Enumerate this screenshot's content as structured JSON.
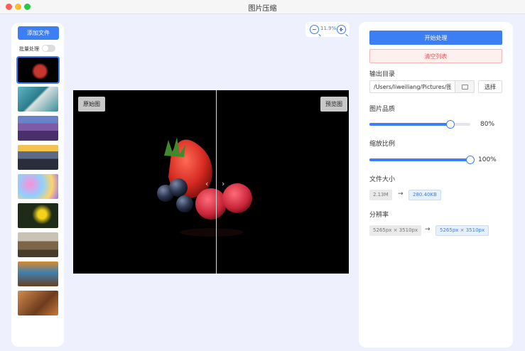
{
  "window": {
    "title": "图片压缩"
  },
  "sidebar": {
    "add_files_label": "添加文件",
    "batch_label": "批量处理",
    "batch_enabled": false,
    "thumbnails": [
      {
        "name": "strawberries",
        "active": true
      },
      {
        "name": "coast"
      },
      {
        "name": "lavender-field"
      },
      {
        "name": "mountain-sunset"
      },
      {
        "name": "bokeh"
      },
      {
        "name": "yellow-flowers"
      },
      {
        "name": "boardwalk"
      },
      {
        "name": "waterfall"
      },
      {
        "name": "autumn-deer"
      }
    ]
  },
  "preview": {
    "zoom_level": "11.9%",
    "original_tag": "原始图",
    "preview_tag": "预览图",
    "left_arrow": "‹",
    "right_arrow": "›"
  },
  "panel": {
    "start_label": "开始处理",
    "clear_label": "清空列表",
    "output_dir_label": "输出目录",
    "output_dir_value": "/Users/liweiliang/Pictures/图",
    "choose_label": "选择",
    "quality_label": "图片品质",
    "quality_value": 80,
    "quality_text": "80%",
    "scale_label": "缩放比例",
    "scale_value": 100,
    "scale_text": "100%",
    "filesize_label": "文件大小",
    "filesize_before": "2.13M",
    "filesize_after": "280.40KB",
    "resolution_label": "分辨率",
    "resolution_before": "5265px × 3510px",
    "resolution_after": "5265px × 3510px",
    "arrow_glyph": "→"
  },
  "colors": {
    "accent": "#3c7ef4",
    "danger": "#e05555",
    "background": "#eef0fd"
  }
}
